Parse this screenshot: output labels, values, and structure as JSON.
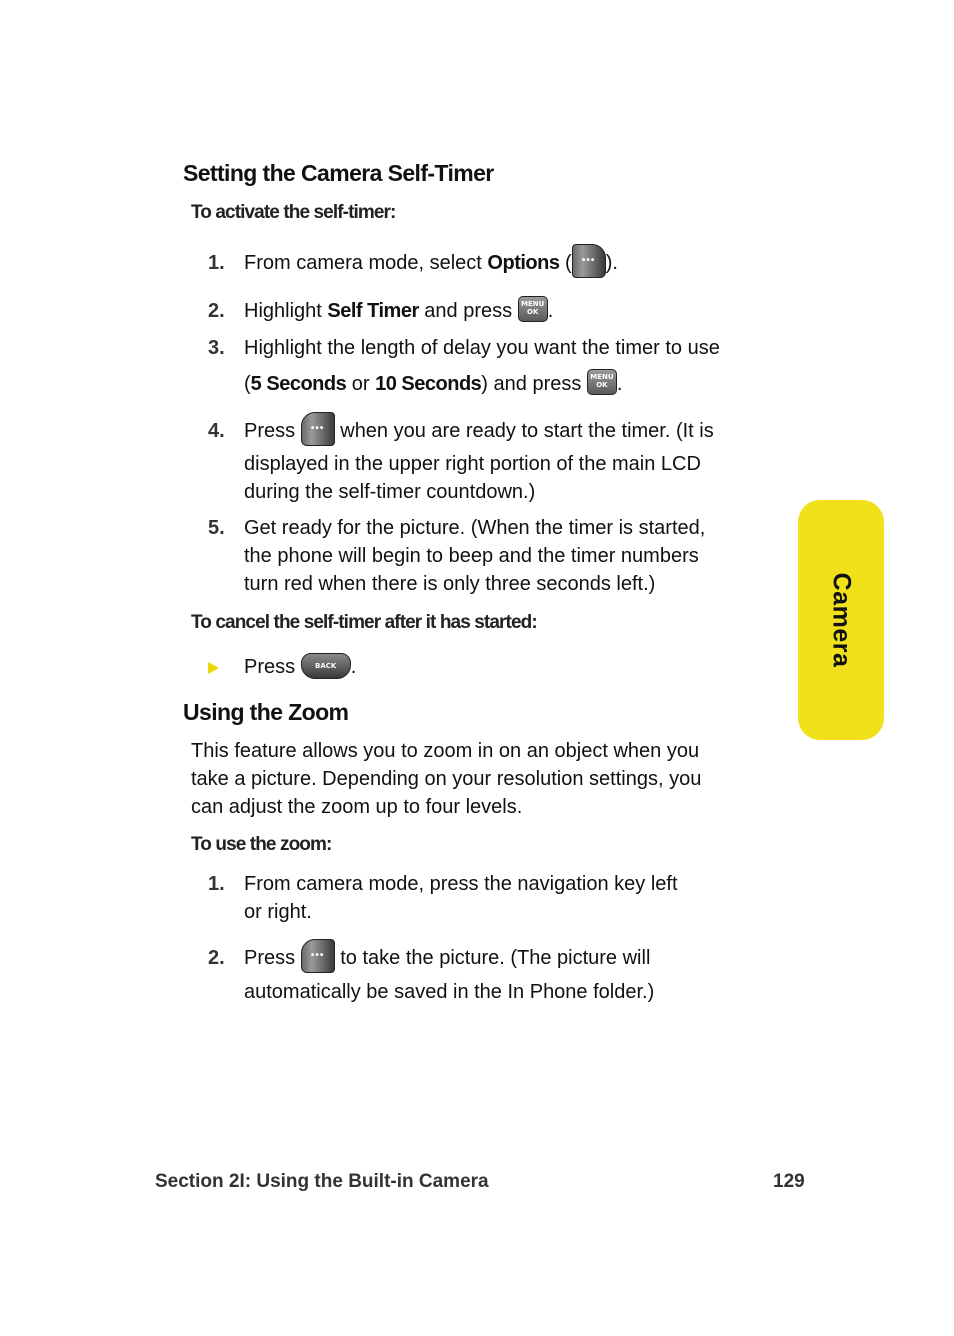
{
  "section1": {
    "heading": "Setting the Camera Self-Timer",
    "subheading_activate": "To activate the self-timer:",
    "steps": [
      {
        "num": "1.",
        "pre": "From camera mode, select ",
        "bold": "Options",
        "post_open": " (",
        "post_close": ").",
        "key": "options-softkey"
      },
      {
        "num": "2.",
        "pre": "Highlight ",
        "bold": "Self Timer",
        "post": " and press ",
        "end": ".",
        "key": "menu-ok"
      },
      {
        "num": "3.",
        "line1": "Highlight the length of delay you want the timer to use",
        "open": "(",
        "bold1": "5 Seconds",
        "mid": " or ",
        "bold2": "10 Seconds",
        "post": ") and press ",
        "end": ".",
        "key": "menu-ok"
      },
      {
        "num": "4.",
        "pre": "Press ",
        "post": " when you are ready to start the timer. (It is",
        "line2": "displayed in the upper right portion of the main LCD",
        "line3": "during the self-timer countdown.)",
        "key": "side-softkey"
      },
      {
        "num": "5.",
        "line1": "Get ready for the picture. (When the timer is started,",
        "line2": "the phone will begin to beep and the timer numbers",
        "line3": "turn red when there is only three seconds left.)"
      }
    ],
    "subheading_cancel": "To cancel the self-timer after it has started:",
    "cancel_step": {
      "pre": "Press ",
      "end": ".",
      "key": "back"
    }
  },
  "section2": {
    "heading": "Using the Zoom",
    "intro": [
      "This feature allows you to zoom in on an object when you",
      "take a picture. Depending on your resolution settings, you",
      "can adjust the zoom up to four levels."
    ],
    "subheading": "To use the zoom:",
    "steps": [
      {
        "num": "1.",
        "line1": "From camera mode, press the navigation key left",
        "line2": "or right."
      },
      {
        "num": "2.",
        "pre": "Press ",
        "post": " to take the picture. (The picture will",
        "line2": "automatically be saved in the In Phone folder.)",
        "key": "side-softkey"
      }
    ]
  },
  "keys": {
    "softkey_glyph": "•••",
    "menu_ok_line1": "MENU",
    "menu_ok_line2": "OK",
    "back_label": "BACK"
  },
  "side_tab": {
    "label": "Camera",
    "color": "#f0e11a"
  },
  "footer": {
    "section": "Section 2I: Using the Built-in Camera",
    "page_number": "129"
  }
}
